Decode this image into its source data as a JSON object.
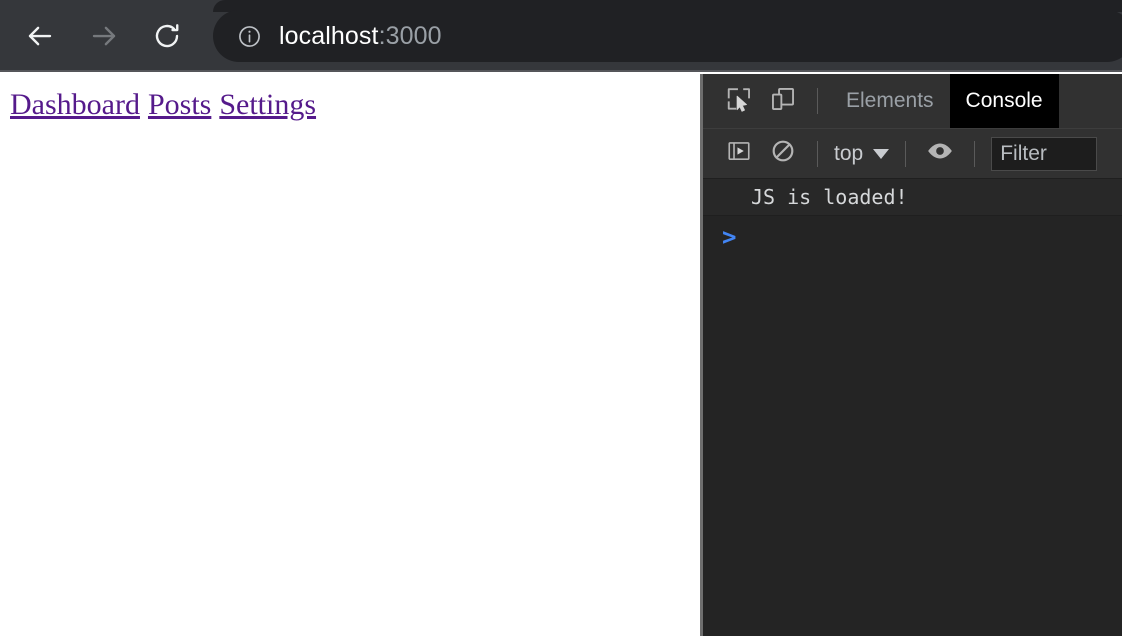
{
  "browser": {
    "back_button": "Back",
    "forward_button": "Forward",
    "reload_button": "Reload this page",
    "omnibox": {
      "site_info": "View site information",
      "url_host": "localhost",
      "url_port": ":3000"
    }
  },
  "page": {
    "links": [
      {
        "label": "Dashboard"
      },
      {
        "label": "Posts"
      },
      {
        "label": "Settings"
      }
    ]
  },
  "devtools": {
    "toolbar": {
      "inspect_label": "Inspect element",
      "device_toolbar_label": "Toggle device toolbar"
    },
    "tabs": [
      {
        "label": "Elements",
        "active": false
      },
      {
        "label": "Console",
        "active": true
      }
    ],
    "console_toolbar": {
      "sidebar_toggle_label": "Show console sidebar",
      "clear_label": "Clear console",
      "context": "top",
      "eye_label": "Create live expression",
      "filter_placeholder": "Filter",
      "filter_value": ""
    },
    "console": {
      "messages": [
        {
          "text": "JS is loaded!"
        }
      ],
      "prompt_caret": ">",
      "prompt_value": ""
    }
  },
  "colors": {
    "toolbar_bg": "#35373b",
    "omnibox_bg": "#202124",
    "devtools_bg": "#242424",
    "devtools_panel_bg": "#313131",
    "active_tab_bg": "#000000",
    "link_color": "#551a8b",
    "prompt_caret_color": "#4285f4",
    "console_text_color": "#d6d8da"
  }
}
